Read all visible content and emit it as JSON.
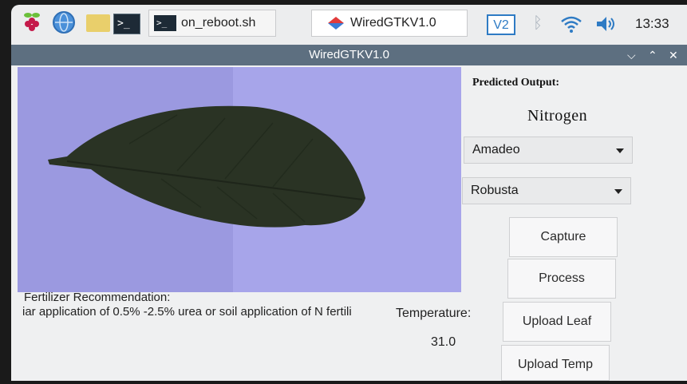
{
  "taskbar": {
    "buttons": [
      {
        "label": "on_reboot.sh"
      },
      {
        "label": "WiredGTKV1.0"
      }
    ],
    "tray": {
      "vnc": "V2",
      "time": "13:33"
    }
  },
  "window": {
    "title": "WiredGTKV1.0",
    "predicted_output_label": "Predicted Output:",
    "predicted_output_value": "Nitrogen",
    "combo_variety": "Amadeo",
    "combo_species": "Robusta",
    "buttons": {
      "capture": "Capture",
      "process": "Process",
      "upload_leaf": "Upload Leaf",
      "upload_temp": "Upload Temp"
    },
    "fertilizer_label": "Fertilizer Recommendation:",
    "fertilizer_text": "iar application of 0.5% -2.5% urea or soil application of N fertili",
    "temperature_label": "Temperature:",
    "temperature_value": "31.0"
  },
  "colors": {
    "titlebar": "#5d6f80",
    "leaf_background": "#9b99e0",
    "leaf": "#2a3324"
  }
}
